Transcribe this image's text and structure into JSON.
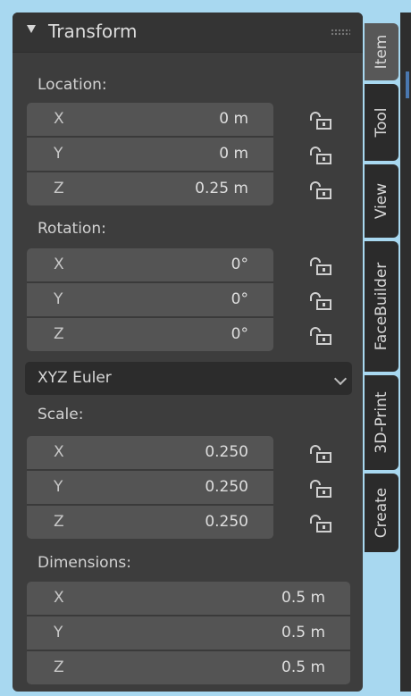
{
  "panel": {
    "title": "Transform"
  },
  "location": {
    "label": "Location:",
    "rows": [
      {
        "axis": "X",
        "value": "0 m"
      },
      {
        "axis": "Y",
        "value": "0 m"
      },
      {
        "axis": "Z",
        "value": "0.25 m"
      }
    ]
  },
  "rotation": {
    "label": "Rotation:",
    "rows": [
      {
        "axis": "X",
        "value": "0°"
      },
      {
        "axis": "Y",
        "value": "0°"
      },
      {
        "axis": "Z",
        "value": "0°"
      }
    ],
    "mode": "XYZ Euler"
  },
  "scale": {
    "label": "Scale:",
    "rows": [
      {
        "axis": "X",
        "value": "0.250"
      },
      {
        "axis": "Y",
        "value": "0.250"
      },
      {
        "axis": "Z",
        "value": "0.250"
      }
    ]
  },
  "dimensions": {
    "label": "Dimensions:",
    "rows": [
      {
        "axis": "X",
        "value": "0.5 m"
      },
      {
        "axis": "Y",
        "value": "0.5 m"
      },
      {
        "axis": "Z",
        "value": "0.5 m"
      }
    ]
  },
  "tabs": [
    {
      "label": "Item",
      "active": true
    },
    {
      "label": "Tool",
      "active": false
    },
    {
      "label": "View",
      "active": false
    },
    {
      "label": "FaceBuilder",
      "active": false
    },
    {
      "label": "3D-Print",
      "active": false
    },
    {
      "label": "Create",
      "active": false
    }
  ],
  "icons": {
    "collapse": "triangle-down-icon",
    "grip": "drag-grip-icon",
    "lock": "unlocked-padlock-icon"
  },
  "colors": {
    "panel_bg": "#3d3d3d",
    "field_bg": "#545454",
    "accent": "#4a78b0"
  }
}
